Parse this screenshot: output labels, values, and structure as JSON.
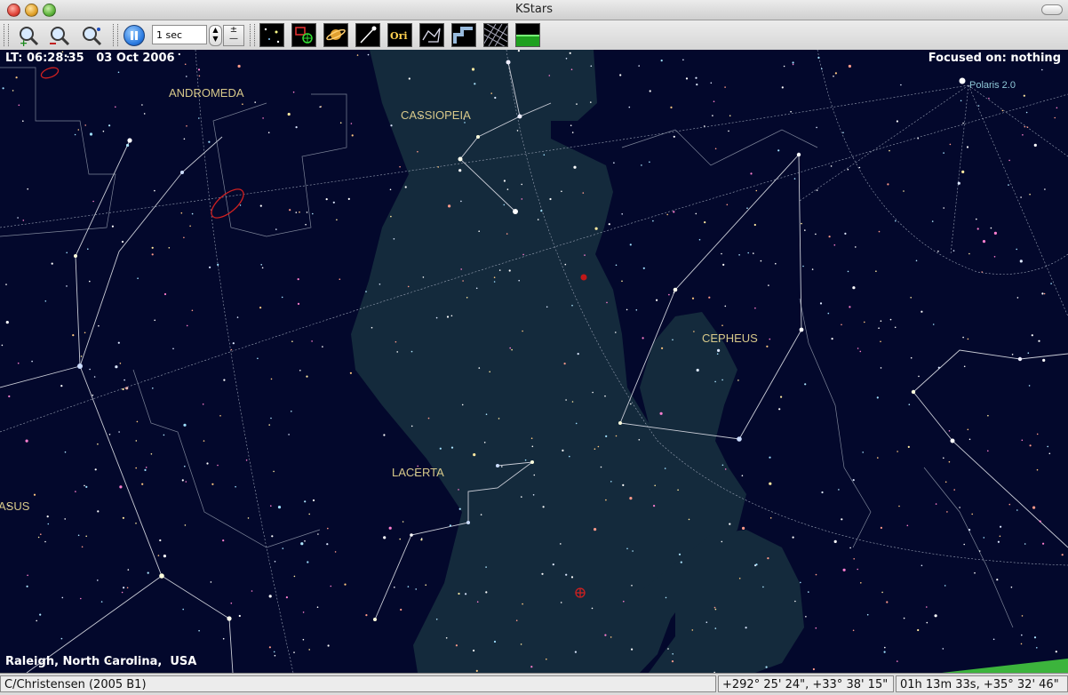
{
  "window": {
    "title": "KStars"
  },
  "toolbar": {
    "zoom_in": "zoom-in-icon",
    "zoom_out": "zoom-out-icon",
    "find": "find-object-icon",
    "pause": "pause-clock-icon",
    "time_step": "1 sec",
    "view_buttons": [
      "stars-icon",
      "deep-sky-objects-icon",
      "solar-system-icon",
      "comets-icon",
      "constellation-names-icon",
      "constellation-lines-icon",
      "constellation-boundaries-icon",
      "coordinate-grid-icon",
      "horizon-icon"
    ]
  },
  "sky": {
    "local_time": "LT: 06:28:35   03 Oct 2006",
    "focus": "Focused on: nothing",
    "location": "Raleigh, North Carolina,  USA",
    "labels": {
      "andromeda": "ANDROMEDA",
      "cassiopeia": "CASSIOPEIA",
      "cepheus": "CEPHEUS",
      "lacerta": "LACERTA",
      "pegasus": "ASUS",
      "polaris": "Polaris 2.0"
    },
    "colors": {
      "sky": "#03082c",
      "milky_way": "#142a3c",
      "label": "#d8c98a",
      "polaris": "#8fc8d8",
      "lines": "#9aa3b5"
    }
  },
  "statusbar": {
    "object": "C/Christensen (2005 B1)",
    "altaz": "+292° 25' 24\",  +33° 38' 15\"",
    "radec": "01h 13m 33s,  +35° 32' 46\""
  }
}
